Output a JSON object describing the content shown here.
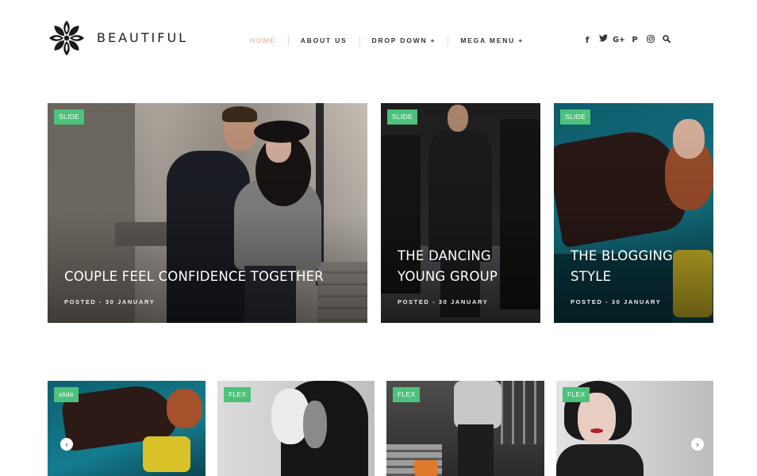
{
  "brand": {
    "name": "BEAUTIFUL",
    "logo_icon": "flower-ornament-icon"
  },
  "nav": {
    "items": [
      {
        "label": "HOME",
        "active": true
      },
      {
        "label": "ABOUT US"
      },
      {
        "label": "DROP DOWN +"
      },
      {
        "label": "MEGA MENU +"
      }
    ]
  },
  "social": {
    "facebook": "f",
    "twitter": "🐦",
    "google_plus": "G+",
    "pinterest": "P",
    "instagram": "◎",
    "search": "⌕"
  },
  "featured": [
    {
      "badge": "SLIDE",
      "title": "COUPLE FEEL CONFIDENCE TOGETHER",
      "meta": "POSTED - 30 JANUARY"
    },
    {
      "badge": "SLIDE",
      "title": "THE DANCING YOUNG GROUP",
      "meta": "POSTED - 30 JANUARY"
    },
    {
      "badge": "SLIDE",
      "title": "THE BLOGGING STYLE",
      "meta": "POSTED - 30 JANUARY"
    }
  ],
  "carousel": {
    "cards": [
      {
        "badge": "slide"
      },
      {
        "badge": "FLEX"
      },
      {
        "badge": "FLEX"
      },
      {
        "badge": "FLEX"
      }
    ],
    "prev_icon": "‹",
    "next_icon": "›"
  },
  "colors": {
    "accent": "#4cc27b",
    "nav_active": "#e8a07f"
  }
}
